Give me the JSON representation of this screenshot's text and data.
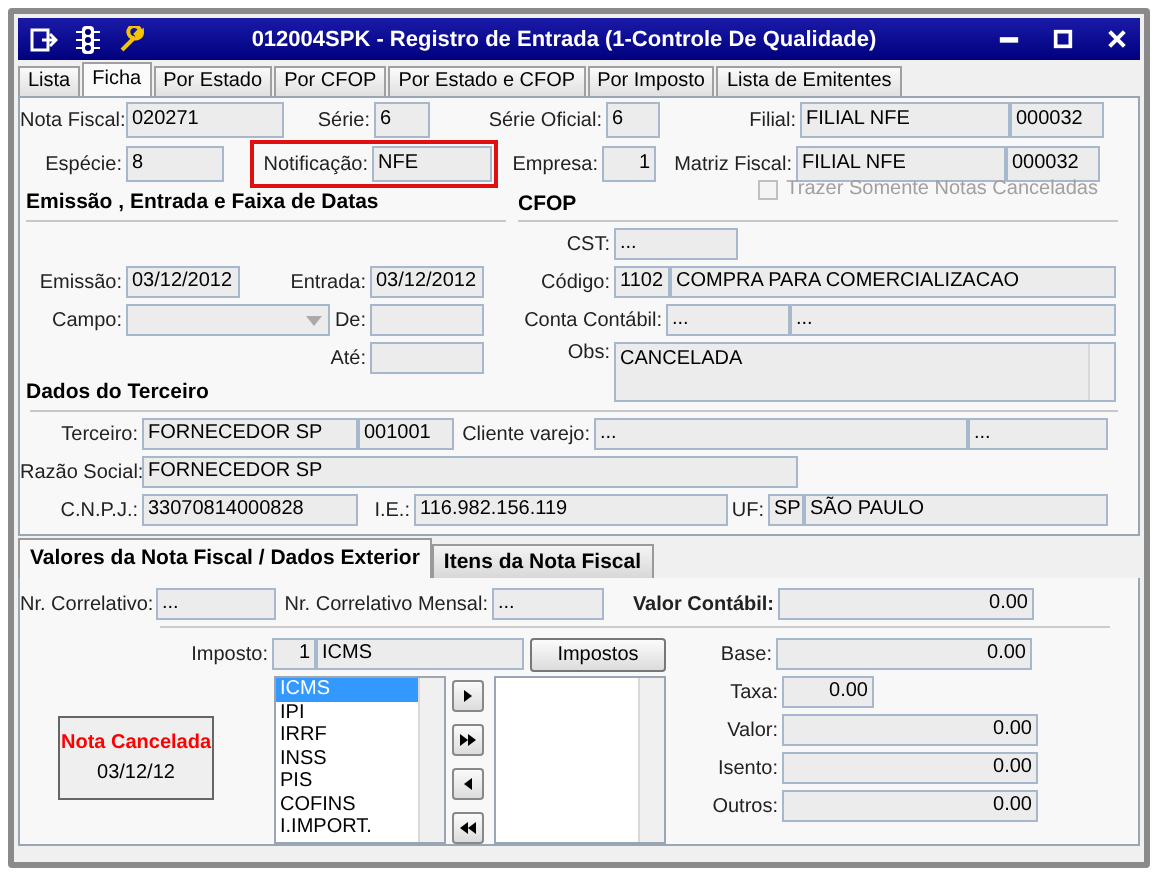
{
  "window": {
    "title": "012004SPK - Registro de Entrada (1-Controle De Qualidade)"
  },
  "tabs": [
    {
      "label": "Lista",
      "selected": false
    },
    {
      "label": "Ficha",
      "selected": true
    },
    {
      "label": "Por Estado",
      "selected": false
    },
    {
      "label": "Por CFOP",
      "selected": false
    },
    {
      "label": "Por Estado e CFOP",
      "selected": false
    },
    {
      "label": "Por Imposto",
      "selected": false
    },
    {
      "label": "Lista de Emitentes",
      "selected": false
    }
  ],
  "nota_fiscal": {
    "label": "Nota Fiscal:",
    "value": "020271"
  },
  "serie": {
    "label": "Série:",
    "value": "6"
  },
  "serie_oficial": {
    "label": "Série Oficial:",
    "value": "6"
  },
  "filial": {
    "label": "Filial:",
    "name": "FILIAL NFE",
    "code": "000032"
  },
  "especie": {
    "label": "Espécie:",
    "value": "8"
  },
  "notificacao": {
    "label": "Notificação:",
    "value": "NFE",
    "highlighted": true
  },
  "empresa": {
    "label": "Empresa:",
    "value": "1"
  },
  "matriz_fiscal": {
    "label": "Matriz Fiscal:",
    "name": "FILIAL NFE",
    "code": "000032"
  },
  "cancel_filter": {
    "label": "Trazer Somente Notas Canceladas",
    "checked": false,
    "disabled": true
  },
  "dates": {
    "title": "Emissão , Entrada e Faixa de Datas",
    "emissao": {
      "label": "Emissão:",
      "value": "03/12/2012"
    },
    "entrada": {
      "label": "Entrada:",
      "value": "03/12/2012"
    },
    "campo": {
      "label": "Campo:"
    },
    "de": {
      "label": "De:"
    },
    "ate": {
      "label": "Até:"
    }
  },
  "cfop": {
    "title": "CFOP",
    "cst": {
      "label": "CST:",
      "value": "..."
    },
    "codigo": {
      "label": "Código:",
      "code": "1102",
      "name": "COMPRA PARA COMERCIALIZACAO"
    },
    "conta_contabil": {
      "label": "Conta Contábil:",
      "code": "...",
      "name": "..."
    },
    "obs": {
      "label": "Obs:",
      "value": "CANCELADA"
    }
  },
  "terceiro": {
    "title": "Dados do Terceiro",
    "terceiro": {
      "label": "Terceiro:",
      "name": "FORNECEDOR SP",
      "code": "001001"
    },
    "cliente_varejo": {
      "label": "Cliente varejo:",
      "name": "...",
      "code": "..."
    },
    "razao_social": {
      "label": "Razão Social:",
      "value": "FORNECEDOR SP"
    },
    "cnpj": {
      "label": "C.N.P.J.:",
      "value": "33070814000828"
    },
    "ie": {
      "label": "I.E.:",
      "value": "116.982.156.119"
    },
    "uf": {
      "label": "UF:",
      "code": "SP",
      "name": "SÃO PAULO"
    }
  },
  "bottom_tabs": [
    {
      "label": "Valores da Nota Fiscal / Dados Exterior",
      "selected": true
    },
    {
      "label": "Itens da Nota Fiscal",
      "selected": false
    }
  ],
  "nr_correlativo": {
    "label": "Nr. Correlativo:",
    "value": "..."
  },
  "nr_correlativo_mensal": {
    "label": "Nr. Correlativo Mensal:",
    "value": "..."
  },
  "valor_contabil": {
    "label": "Valor Contábil:",
    "value": "0.00"
  },
  "imposto": {
    "label": "Imposto:",
    "code": "1",
    "name": "ICMS"
  },
  "impostos_button": "Impostos",
  "tax_list": [
    {
      "label": "ICMS",
      "selected": true
    },
    {
      "label": "IPI",
      "selected": false
    },
    {
      "label": "IRRF",
      "selected": false
    },
    {
      "label": "INSS",
      "selected": false
    },
    {
      "label": "PIS",
      "selected": false
    },
    {
      "label": "COFINS",
      "selected": false
    },
    {
      "label": "I.IMPORT.",
      "selected": false
    }
  ],
  "status": {
    "title": "Nota Cancelada",
    "date": "03/12/12"
  },
  "amounts": [
    {
      "label": "Base:",
      "value": "0.00",
      "kind": "wide"
    },
    {
      "label": "Taxa:",
      "value": "0.00",
      "kind": "narrow"
    },
    {
      "label": "Valor:",
      "value": "0.00",
      "kind": "wide"
    },
    {
      "label": "Isento:",
      "value": "0.00",
      "kind": "wide"
    },
    {
      "label": "Outros:",
      "value": "0.00",
      "kind": "wide"
    }
  ]
}
